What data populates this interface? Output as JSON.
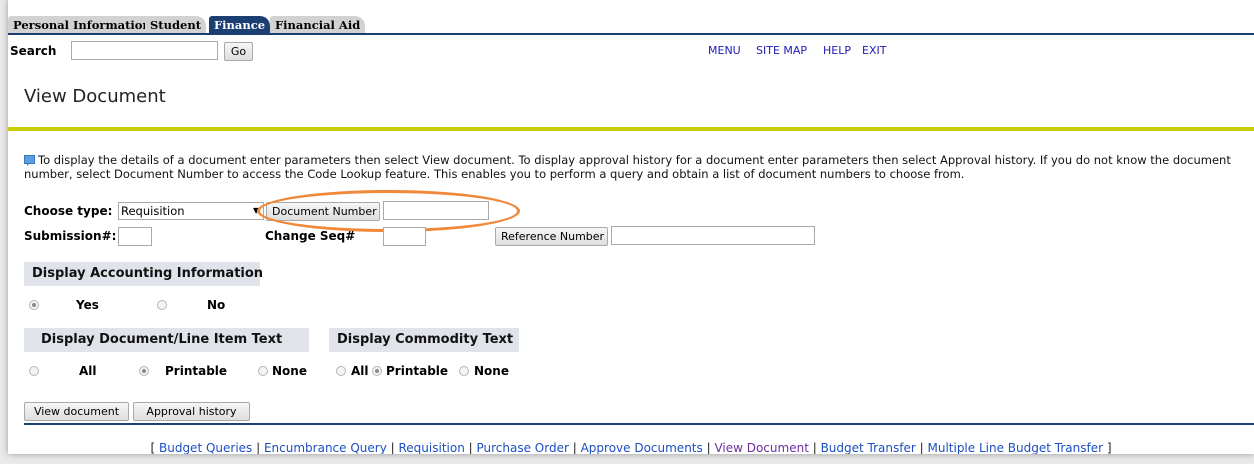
{
  "tabs": [
    "Personal Information",
    "Student",
    "Finance",
    "Financial Aid"
  ],
  "search": {
    "label": "Search",
    "value": "",
    "go_label": "Go"
  },
  "top_links": [
    "MENU",
    "SITE MAP",
    "HELP",
    "EXIT"
  ],
  "page_title": "View Document",
  "info_text": "To display the details of a document enter parameters then select View document. To display approval history for a document enter parameters then select Approval history. If you do not know the document number, select Document Number to access the Code Lookup feature. This enables you to perform a query and obtain a list of document numbers to choose from.",
  "form": {
    "choose_type_label": "Choose type:",
    "choose_type_value": "Requisition",
    "document_number_button": "Document Number",
    "document_number_value": "",
    "submission_label": "Submission#:",
    "submission_value": "",
    "change_seq_label": "Change Seq#",
    "change_seq_value": "",
    "reference_number_button": "Reference Number",
    "reference_number_value": ""
  },
  "accounting": {
    "header": "Display Accounting Information",
    "options": [
      "Yes",
      "No"
    ],
    "selected": "Yes"
  },
  "doc_text": {
    "header": "Display Document/Line Item Text",
    "options": [
      "All",
      "Printable",
      "None"
    ],
    "selected": "Printable"
  },
  "commodity_text": {
    "header": "Display Commodity Text",
    "options": [
      "All",
      "Printable",
      "None"
    ],
    "selected": "Printable"
  },
  "actions": {
    "view_document": "View document",
    "approval_history": "Approval history"
  },
  "footer_links": [
    "Budget Queries",
    "Encumbrance Query",
    "Requisition",
    "Purchase Order",
    "Approve Documents",
    "View Document",
    "Budget Transfer",
    "Multiple Line Budget Transfer"
  ],
  "colors": {
    "nav_blue": "#1c3f73",
    "accent_rule": "#c8cc00",
    "highlight_oval": "#f0883a",
    "link": "#1d1ab5"
  }
}
